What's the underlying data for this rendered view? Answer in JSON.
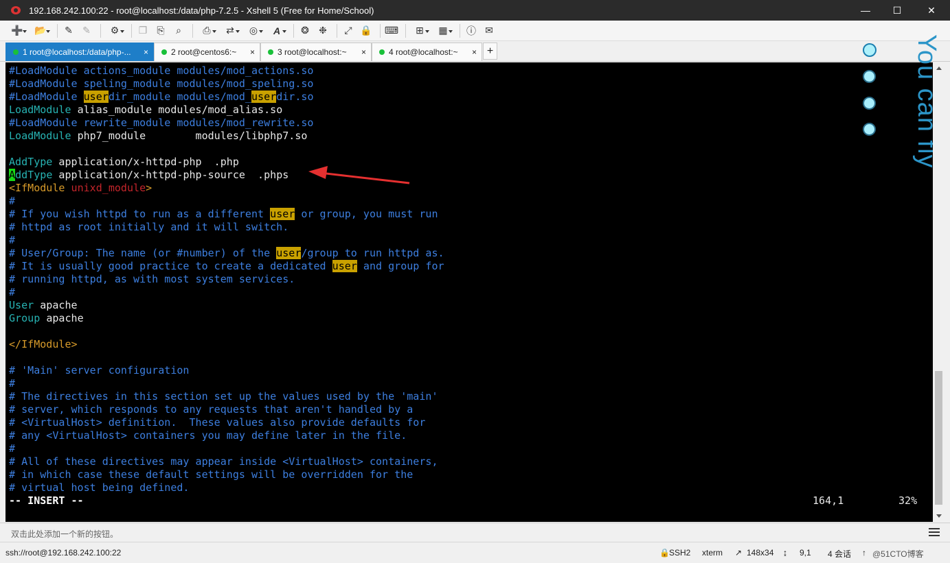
{
  "window": {
    "title": "192.168.242.100:22 - root@localhost:/data/php-7.2.5 - Xshell 5 (Free for Home/School)",
    "minimize_glyph": "—",
    "maximize_glyph": "☐",
    "close_glyph": "✕"
  },
  "toolbar": {
    "icons": [
      "new-session-icon",
      "open-folder-icon",
      "reconnect-icon",
      "disconnect-icon",
      "properties-icon",
      "copy-icon",
      "paste-icon",
      "find-icon",
      "print-icon",
      "transfer-icon",
      "globe-icon",
      "font-icon",
      "xftp-icon",
      "xagent-icon",
      "fullscreen-icon",
      "lock-icon",
      "keyboard-icon",
      "new-tab-icon",
      "layout-icon",
      "help-icon",
      "chat-icon"
    ]
  },
  "tabs": [
    {
      "label": "1 root@localhost:/data/php-...",
      "active": true,
      "close": "×"
    },
    {
      "label": "2 root@centos6:~",
      "active": false,
      "close": "×"
    },
    {
      "label": "3 root@localhost:~",
      "active": false,
      "close": "×"
    },
    {
      "label": "4 root@localhost:~",
      "active": false,
      "close": "×"
    }
  ],
  "tab_add": "+",
  "terminal": {
    "l1": {
      "a": "#LoadModule actions_module modules/mod_actions.so"
    },
    "l2": {
      "a": "#LoadModule speling_module modules/mod_speling.so"
    },
    "l3": {
      "a": "#LoadModule ",
      "h1": "user",
      "b": "dir_module modules/mod_",
      "h2": "user",
      "c": "dir.so"
    },
    "l4": {
      "kw": "LoadModule",
      "rest": " alias_module modules/mod_alias.so"
    },
    "l5": {
      "a": "#LoadModule rewrite_module modules/mod_rewrite.so"
    },
    "l6": {
      "kw": "LoadModule",
      "rest": " php7_module        modules/libphp7.so"
    },
    "l7": {
      "kw": "AddType",
      "rest": " application/x-httpd-php  .php"
    },
    "l8": {
      "cursor": "A",
      "kw": "ddType",
      "rest": " application/x-httpd-php-source  .phps"
    },
    "l9": {
      "open": "<IfModule ",
      "mod": "unixd_module",
      "close": ">"
    },
    "l10": {
      "a": "#"
    },
    "l11": {
      "a": "# If you wish httpd to run as a different ",
      "h1": "user",
      "b": " or group, you must run"
    },
    "l12": {
      "a": "# httpd as root initially and it will switch."
    },
    "l13": {
      "a": "#"
    },
    "l14": {
      "a": "# User/Group: The name (or #number) of the ",
      "h1": "user",
      "b": "/group to run httpd as."
    },
    "l15": {
      "a": "# It is usually good practice to create a dedicated ",
      "h1": "user",
      "b": " and group for"
    },
    "l16": {
      "a": "# running httpd, as with most system services."
    },
    "l17": {
      "a": "#"
    },
    "l18": {
      "kw": "User",
      "rest": " apache"
    },
    "l19": {
      "kw": "Group",
      "rest": " apache"
    },
    "l20": {
      "a": "</IfModule>"
    },
    "l21": {
      "a": "# 'Main' server configuration"
    },
    "l22": {
      "a": "#"
    },
    "l23": {
      "a": "# The directives in this section set up the values used by the 'main'"
    },
    "l24": {
      "a": "# server, which responds to any requests that aren't handled by a"
    },
    "l25": {
      "a": "# <VirtualHost> definition.  These values also provide defaults for"
    },
    "l26": {
      "a": "# any <VirtualHost> containers you may define later in the file."
    },
    "l27": {
      "a": "#"
    },
    "l28": {
      "a": "# All of these directives may appear inside <VirtualHost> containers,"
    },
    "l29": {
      "a": "# in which case these default settings will be overridden for the"
    },
    "l30": {
      "a": "# virtual host being defined."
    },
    "mode": "-- INSERT --",
    "position": "164,1",
    "percent": "32%"
  },
  "overlay": {
    "vertical_text": "You can fly"
  },
  "colors": {
    "comment": "#3d7fe0",
    "keyword": "#27b3b3",
    "highlight": "#c9a100",
    "cursor": "#18d818",
    "tag": "#d89b2a",
    "arrow": "#e53030",
    "active_tab": "#1e7ec8"
  },
  "compose": {
    "placeholder": "双击此处添加一个新的按钮。"
  },
  "status": {
    "connection": "ssh://root@192.168.242.100:22",
    "protocol": "SSH2",
    "terminal_type": "xterm",
    "size": "148x34",
    "cursor_pos": "9,1",
    "sessions": "4 会话",
    "watermark": "@51CTO博客"
  }
}
